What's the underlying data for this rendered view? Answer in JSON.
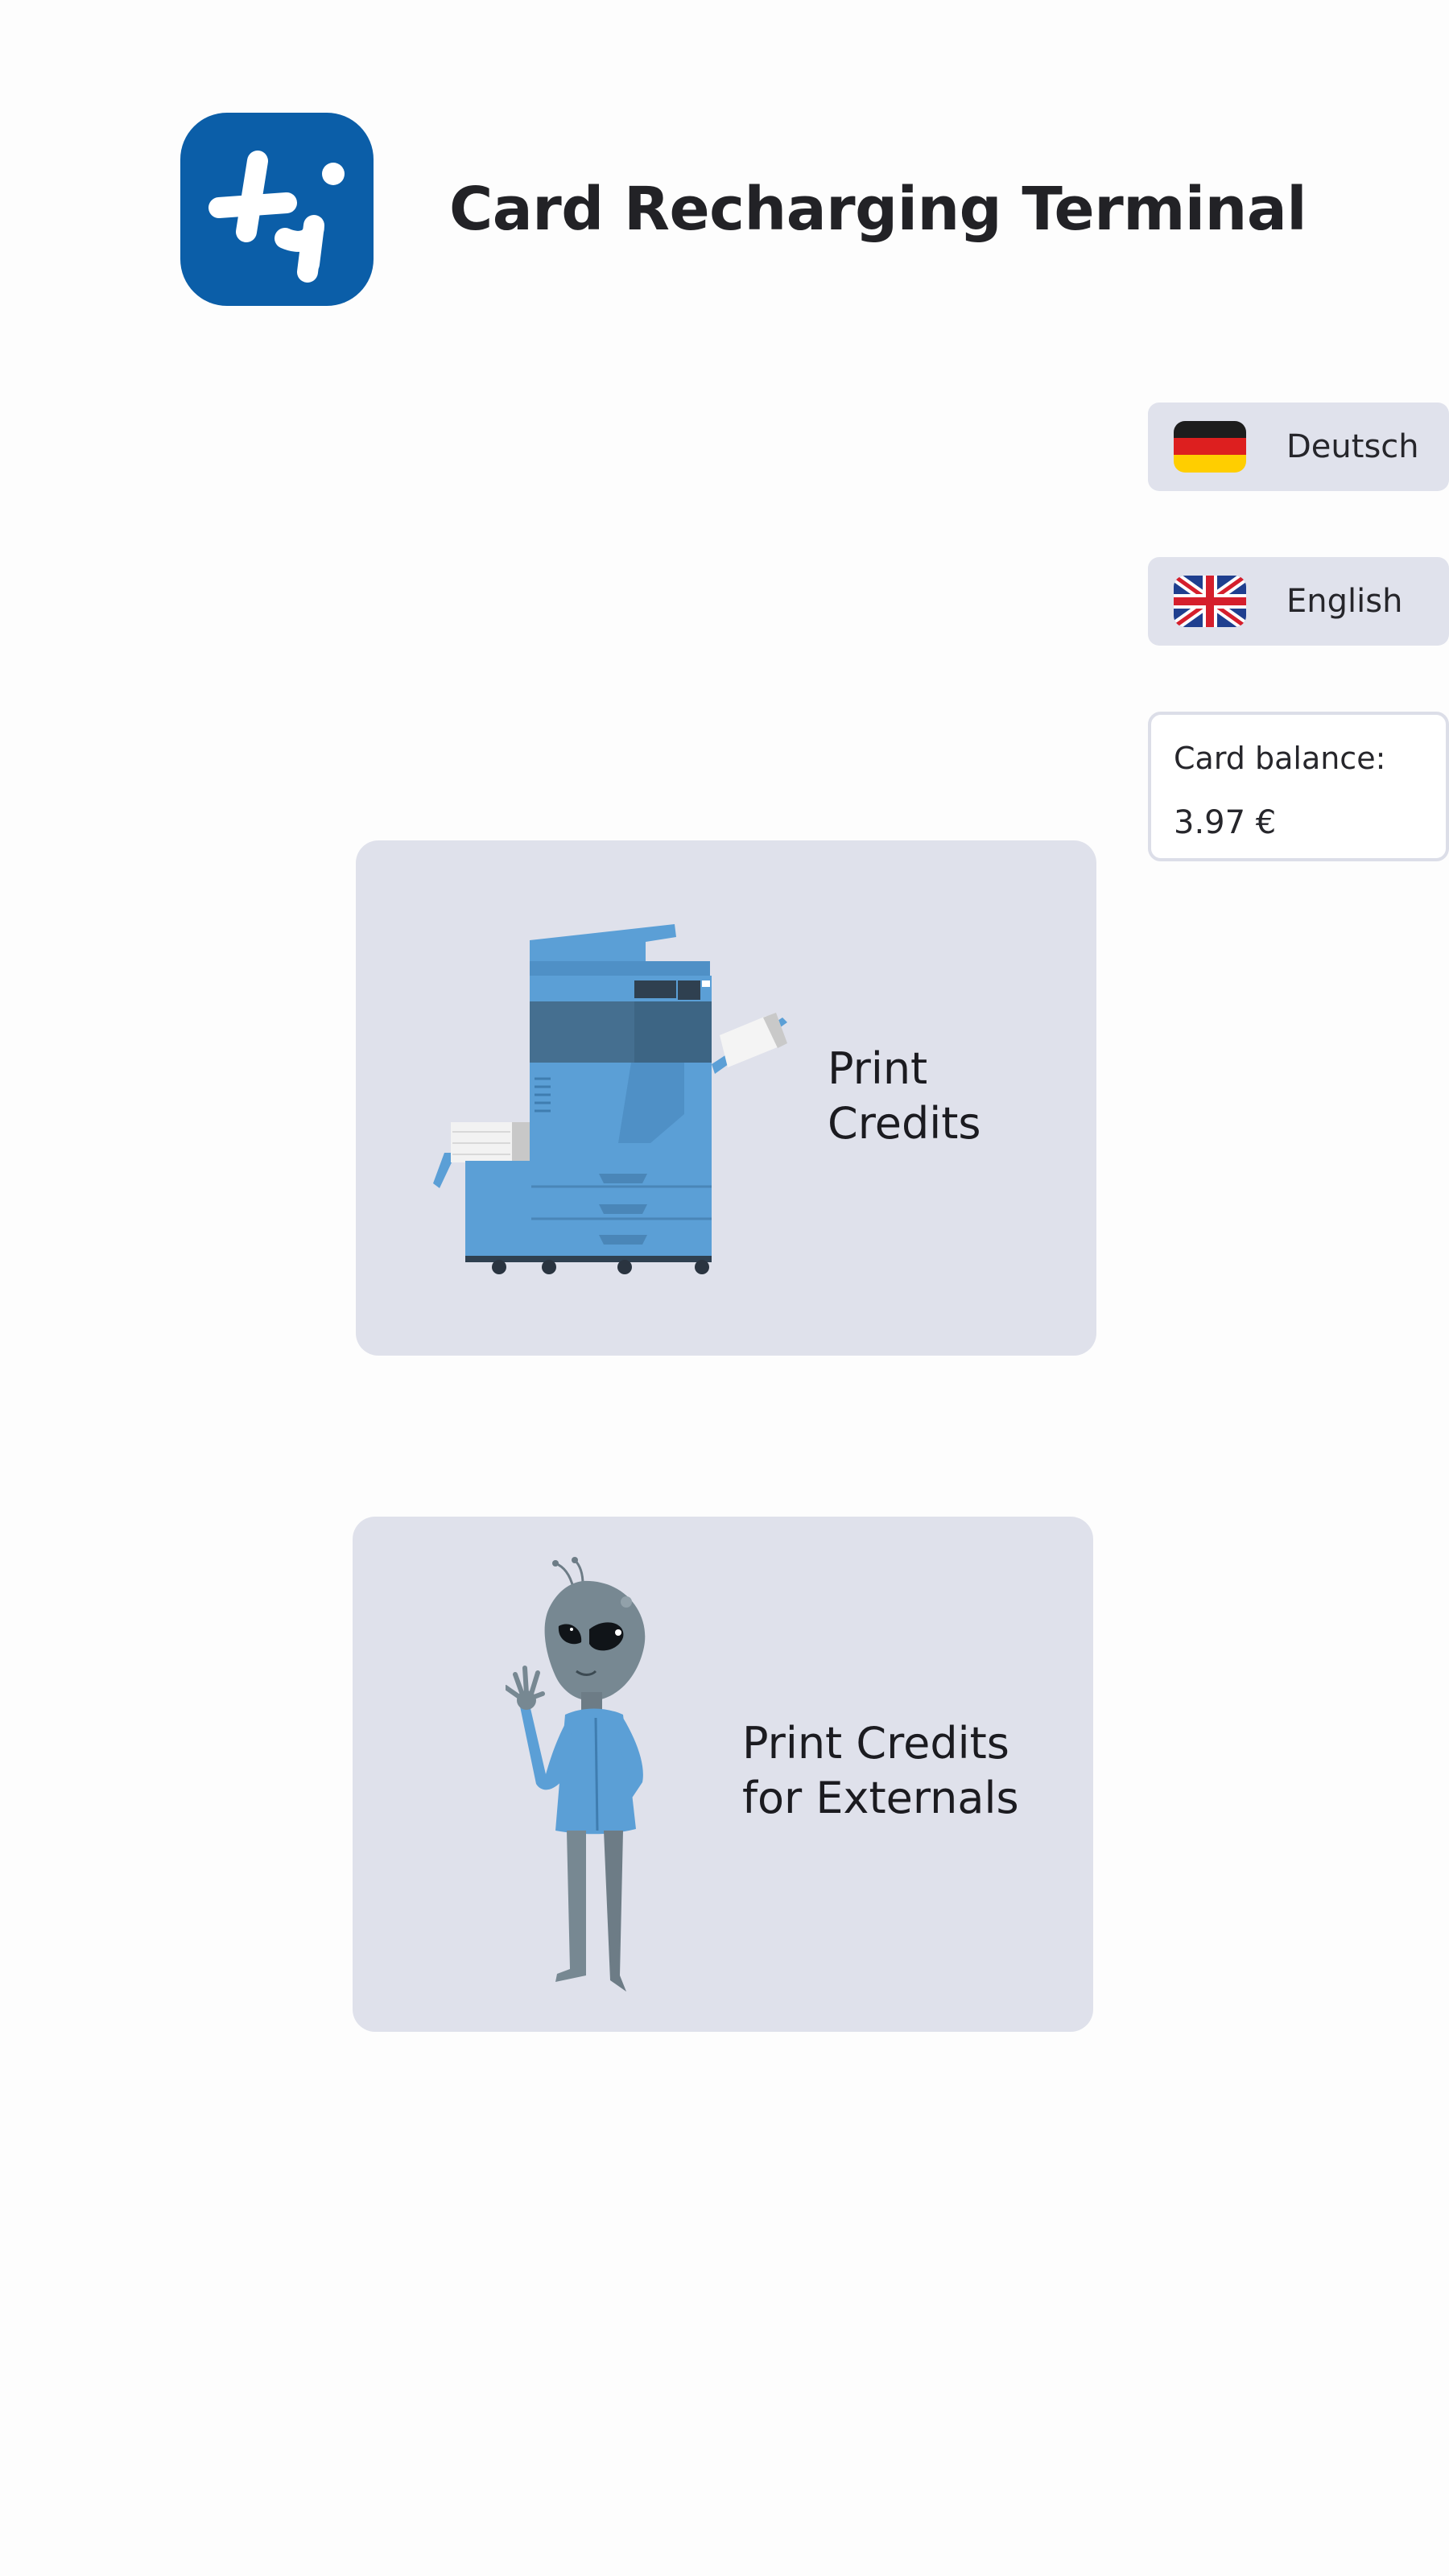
{
  "header": {
    "title": "Card Recharging Terminal",
    "logo_icon": "app-logo-icon"
  },
  "languages": [
    {
      "label": "Deutsch",
      "flag_icon": "german-flag-icon"
    },
    {
      "label": "English",
      "flag_icon": "uk-flag-icon"
    }
  ],
  "balance": {
    "label": "Card balance:",
    "value": "3.97 €"
  },
  "cards": {
    "print": {
      "label": "Print\nCredits",
      "icon": "printer-icon"
    },
    "external": {
      "label": "Print Credits\nfor Externals",
      "icon": "alien-icon"
    }
  },
  "colors": {
    "brand": "#0b5ea8",
    "card_background": "#dfe1eb",
    "button_background": "#e0e2ec",
    "illustration_blue": "#5b9fd6",
    "alien_grey": "#778892"
  }
}
